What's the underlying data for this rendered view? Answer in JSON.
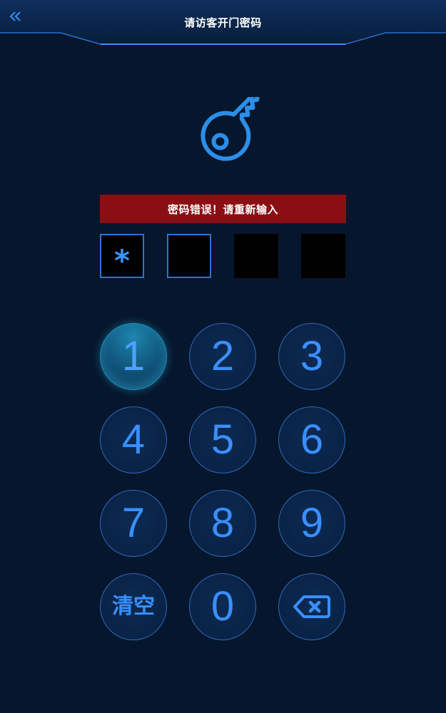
{
  "header": {
    "title": "请访客开门密码",
    "back_icon": "double-chevron-left-icon"
  },
  "key_icon": "key-icon",
  "error_message": "密码错误！请重新输入",
  "pin": {
    "slots": [
      "*",
      "",
      "",
      ""
    ]
  },
  "keypad": {
    "keys": [
      "1",
      "2",
      "3",
      "4",
      "5",
      "6",
      "7",
      "8",
      "9"
    ],
    "clear_label": "清空",
    "zero": "0",
    "delete_icon": "backspace-icon"
  },
  "colors": {
    "background": "#06162c",
    "accent": "#3a8fff",
    "error_bg": "#8a0f14"
  }
}
